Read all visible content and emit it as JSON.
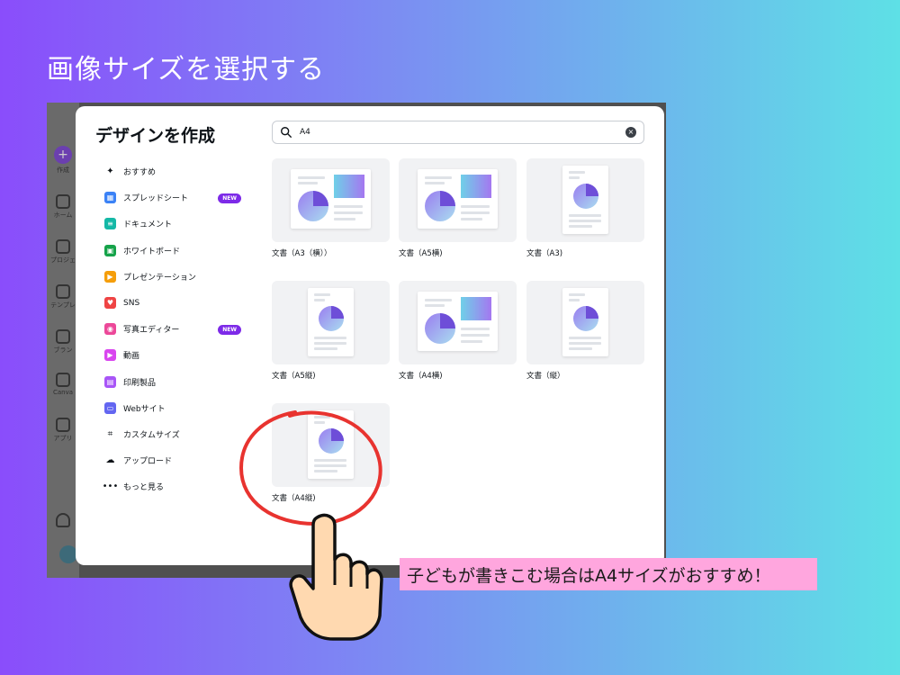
{
  "slide_title": "画像サイズを選択する",
  "background_app": {
    "rail": [
      {
        "label": "作成"
      },
      {
        "label": "ホーム"
      },
      {
        "label": "プロジェ"
      },
      {
        "label": "テンプレ"
      },
      {
        "label": "ブラン"
      },
      {
        "label": "Canva"
      },
      {
        "label": "アプリ"
      }
    ]
  },
  "modal": {
    "title": "デザインを作成",
    "search": {
      "value": "A4"
    },
    "sidebar": [
      {
        "label": "おすすめ",
        "icon": "sparkle-icon",
        "color": "#0e1318"
      },
      {
        "label": "スプレッドシート",
        "icon": "spreadsheet-icon",
        "color": "#3b82f6",
        "badge": "NEW"
      },
      {
        "label": "ドキュメント",
        "icon": "document-icon",
        "color": "#14b8a6"
      },
      {
        "label": "ホワイトボード",
        "icon": "whiteboard-icon",
        "color": "#16a34a"
      },
      {
        "label": "プレゼンテーション",
        "icon": "presentation-icon",
        "color": "#f59e0b"
      },
      {
        "label": "SNS",
        "icon": "heart-icon",
        "color": "#ef4444"
      },
      {
        "label": "写真エディター",
        "icon": "camera-icon",
        "color": "#ec4899",
        "badge": "NEW"
      },
      {
        "label": "動画",
        "icon": "video-icon",
        "color": "#d946ef"
      },
      {
        "label": "印刷製品",
        "icon": "printer-icon",
        "color": "#a855f7"
      },
      {
        "label": "Webサイト",
        "icon": "website-icon",
        "color": "#6366f1"
      },
      {
        "label": "カスタムサイズ",
        "icon": "custom-size-icon",
        "color": "#0e1318"
      },
      {
        "label": "アップロード",
        "icon": "upload-cloud-icon",
        "color": "#0e1318"
      },
      {
        "label": "もっと見る",
        "icon": "more-dots-icon",
        "color": "#0e1318"
      }
    ],
    "results": [
      {
        "label": "文書（A3（横））",
        "orientation": "landscape"
      },
      {
        "label": "文書（A5横)",
        "orientation": "landscape"
      },
      {
        "label": "文書（A3)",
        "orientation": "portrait"
      },
      {
        "label": "文書（A5縦)",
        "orientation": "portrait"
      },
      {
        "label": "文書（A4横)",
        "orientation": "landscape"
      },
      {
        "label": "文書（縦）",
        "orientation": "portrait"
      },
      {
        "label": "文書（A4縦)",
        "orientation": "portrait"
      }
    ]
  },
  "annotation": {
    "caption": "子どもが書きこむ場合はA4サイズがおすすめ！",
    "caption_bg": "#ffa6de",
    "highlight_color": "#e8332f",
    "pointer": "pointing-hand-icon"
  }
}
